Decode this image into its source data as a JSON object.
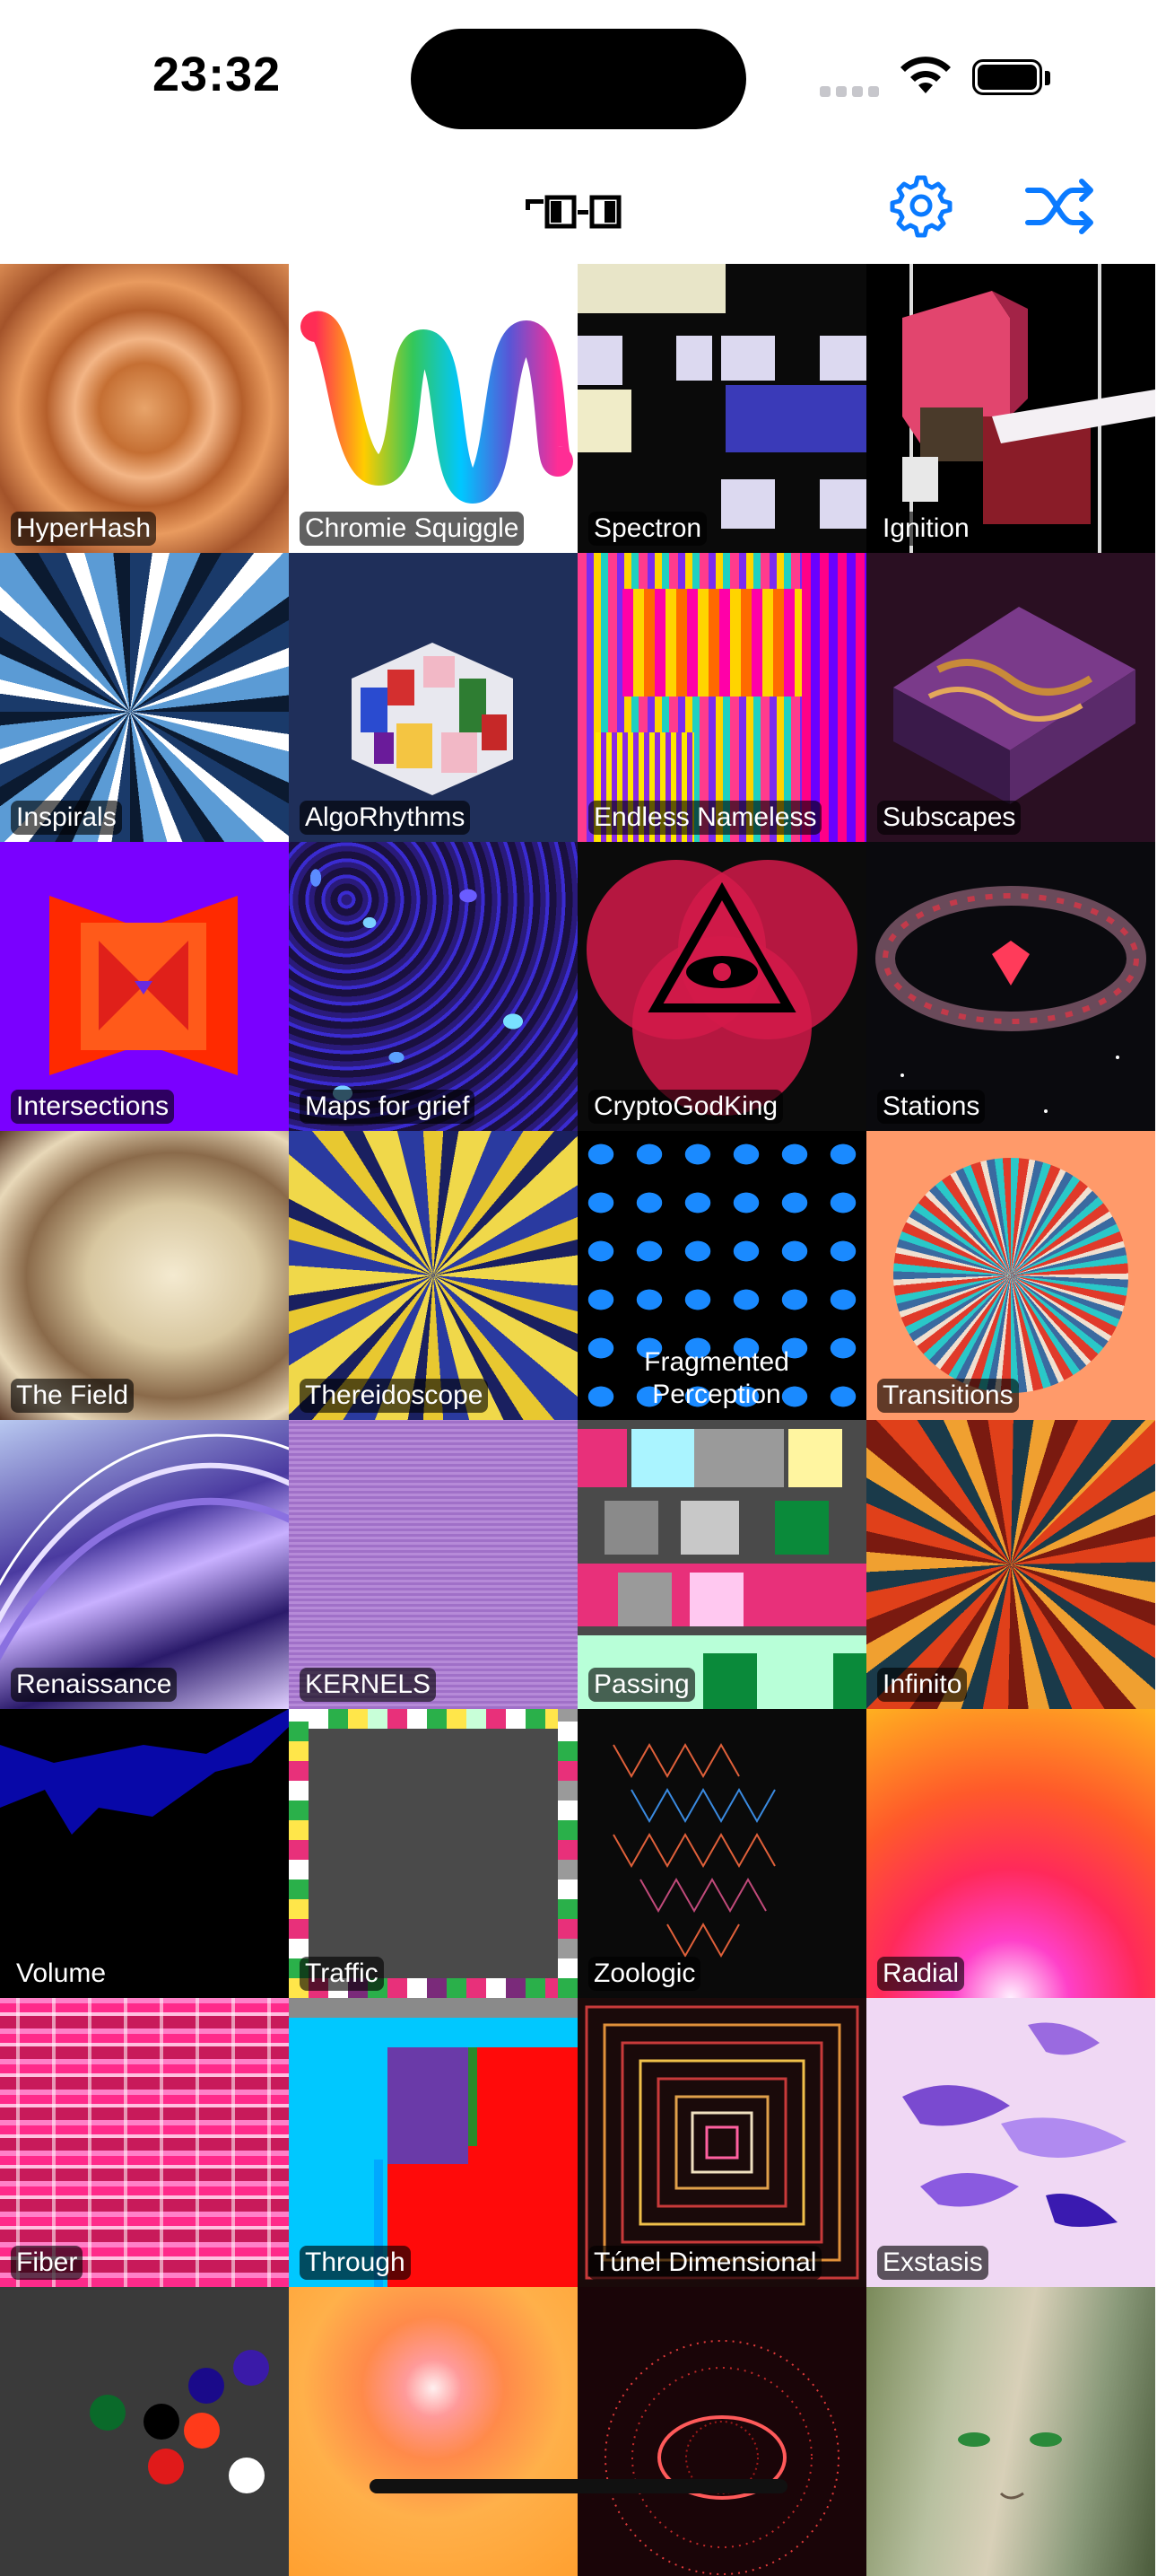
{
  "status_bar": {
    "time": "23:32"
  },
  "nav_bar": {
    "title_logo": "logo-icon",
    "settings_icon": "gear-icon",
    "shuffle_icon": "shuffle-icon",
    "accent_color": "#0a7aff"
  },
  "tiles": [
    {
      "label": "HyperHash"
    },
    {
      "label": "Chromie Squiggle"
    },
    {
      "label": "Spectron"
    },
    {
      "label": "Ignition"
    },
    {
      "label": "Inspirals"
    },
    {
      "label": "AlgoRhythms"
    },
    {
      "label": "Endless Nameless"
    },
    {
      "label": "Subscapes"
    },
    {
      "label": "Intersections"
    },
    {
      "label": "Maps for grief"
    },
    {
      "label": "CryptoGodKing"
    },
    {
      "label": "Stations"
    },
    {
      "label": "The Field"
    },
    {
      "label": "Thereidoscope"
    },
    {
      "label": "Fragmented Perception"
    },
    {
      "label": "Transitions"
    },
    {
      "label": "Renaissance"
    },
    {
      "label": "KERNELS"
    },
    {
      "label": "Passing"
    },
    {
      "label": "Infinito"
    },
    {
      "label": "Volume"
    },
    {
      "label": "Traffic"
    },
    {
      "label": "Zoologic"
    },
    {
      "label": "Radial"
    },
    {
      "label": "Fiber"
    },
    {
      "label": "Through"
    },
    {
      "label": "Túnel Dimensional"
    },
    {
      "label": "Exstasis"
    },
    {
      "label": ""
    },
    {
      "label": ""
    },
    {
      "label": ""
    },
    {
      "label": ""
    }
  ]
}
